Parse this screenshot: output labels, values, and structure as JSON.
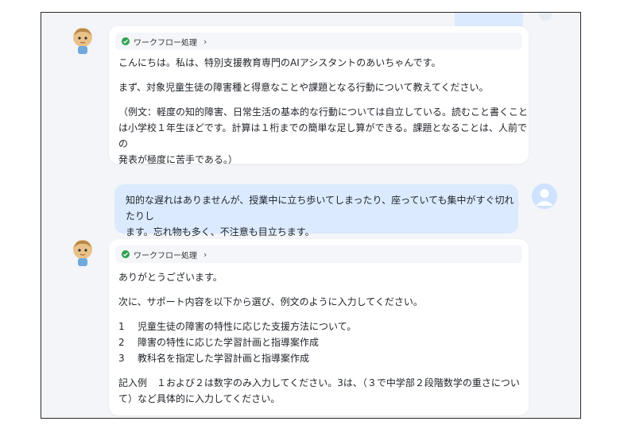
{
  "workflow_label": "ワークフロー処理",
  "bot1": {
    "lines": [
      "こんにちは。私は、特別支援教育専門のAIアシスタントのあいちゃんです。",
      "まず、対象児童生徒の障害種と得意なことや課題となる行動について教えてください。",
      "（例文：軽度の知的障害、日常生活の基本的な行動については自立している。読むこと書くこと",
      "は小学校１年生ほどです。計算は１桁までの簡単な足し算ができる。課題となることは、人前での",
      "発表が極度に苦手である。）"
    ]
  },
  "user1": {
    "lines": [
      "知的な遅れはありませんが、授業中に立ち歩いてしまったり、座っていても集中がすぐ切れたりし",
      "ます。忘れ物も多く、不注意も目立ちます。"
    ]
  },
  "bot2": {
    "greeting": "ありがとうございます。",
    "instruction": "次に、サポート内容を以下から選び、例文のように入力してください。",
    "options": [
      {
        "num": "1",
        "text": "児童生徒の障害の特性に応じた支援方法について。"
      },
      {
        "num": "2",
        "text": "障害の特性に応じた学習計画と指導案作成"
      },
      {
        "num": "3",
        "text": "教科名を指定した学習計画と指導案作成"
      }
    ],
    "example_line1": "記入例　１および２は数字のみ入力してください。3は、（３で中学部２段階数学の重さについ",
    "example_line2": "て）など具体的に入力してください。"
  }
}
